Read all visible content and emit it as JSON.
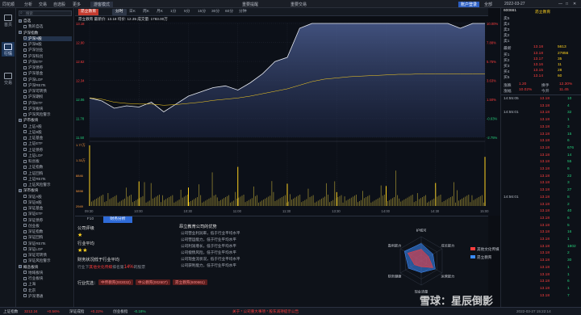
{
  "window": {
    "title": "同花顺",
    "menu": [
      "分析",
      "交易",
      "自选股",
      "更多"
    ],
    "mode_label": "游客模式",
    "center_left": "重要提醒",
    "center_right": "重要交易",
    "top_right": [
      "账户登录",
      "全部",
      "2022-03-27"
    ]
  },
  "leftnav": [
    {
      "label": "首页"
    },
    {
      "label": "行情"
    },
    {
      "label": "交易"
    }
  ],
  "tree": {
    "search_placeholder": "搜索",
    "items": [
      {
        "label": "自选",
        "folder": true
      },
      {
        "label": "我的自选",
        "folder": false
      },
      {
        "label": "沪深指数",
        "folder": true
      },
      {
        "label": "沪深A股",
        "folder": false,
        "selected": true
      },
      {
        "label": "沪深B股",
        "folder": false
      },
      {
        "label": "沪深创业",
        "folder": false
      },
      {
        "label": "沪深科创",
        "folder": false
      },
      {
        "label": "沪深ETF",
        "folder": false
      },
      {
        "label": "沪深债券",
        "folder": false
      },
      {
        "label": "沪深基金",
        "folder": false
      },
      {
        "label": "沪深LOF",
        "folder": false
      },
      {
        "label": "沪深REITs",
        "folder": false
      },
      {
        "label": "沪深可转债",
        "folder": false
      },
      {
        "label": "沪深期权",
        "folder": false
      },
      {
        "label": "沪深ETF",
        "folder": false
      },
      {
        "label": "沪深板块",
        "folder": false
      },
      {
        "label": "沪深风险警示",
        "folder": false
      },
      {
        "label": "沪市板块",
        "folder": true
      },
      {
        "label": "上证A股",
        "folder": false
      },
      {
        "label": "上证B股",
        "folder": false
      },
      {
        "label": "上证基金",
        "folder": false
      },
      {
        "label": "上证ETF",
        "folder": false
      },
      {
        "label": "上证债券",
        "folder": false
      },
      {
        "label": "上证LOF",
        "folder": false
      },
      {
        "label": "科创板",
        "folder": false
      },
      {
        "label": "上证指数",
        "folder": false
      },
      {
        "label": "上证回购",
        "folder": false
      },
      {
        "label": "上证REITs",
        "folder": false
      },
      {
        "label": "上证风险警示",
        "folder": false
      },
      {
        "label": "深市板块",
        "folder": true
      },
      {
        "label": "深证A股",
        "folder": false
      },
      {
        "label": "深证B股",
        "folder": false
      },
      {
        "label": "深证基金",
        "folder": false
      },
      {
        "label": "深证ETF",
        "folder": false
      },
      {
        "label": "深证债券",
        "folder": false
      },
      {
        "label": "创业板",
        "folder": false
      },
      {
        "label": "深证指数",
        "folder": false
      },
      {
        "label": "深证回购",
        "folder": false
      },
      {
        "label": "深证REITs",
        "folder": false
      },
      {
        "label": "深证LOF",
        "folder": false
      },
      {
        "label": "深证可转债",
        "folder": false
      },
      {
        "label": "深证风险警示",
        "folder": false
      },
      {
        "label": "概念板块",
        "folder": true
      },
      {
        "label": "地域板块",
        "folder": false
      },
      {
        "label": "行业板块",
        "folder": false
      },
      {
        "label": "上海",
        "folder": false
      },
      {
        "label": "北京",
        "folder": false
      },
      {
        "label": "沪深港通",
        "folder": false
      }
    ]
  },
  "chart_tabs": [
    "分时",
    "日K",
    "周K",
    "月K",
    "1分",
    "5分",
    "15分",
    "30分",
    "60分",
    "分钟"
  ],
  "chart_tab_active": 0,
  "chart_info": "昂立教育  最新价: 13.18  均价: 12.35  成交量: 1783.00万",
  "chart_data": [
    {
      "type": "line",
      "title": "",
      "x": [
        "09:30",
        "09:35",
        "09:40",
        "09:45",
        "09:50",
        "09:55",
        "10:00",
        "10:05",
        "10:10",
        "10:15",
        "10:20",
        "10:25",
        "10:30",
        "10:35",
        "10:40",
        "10:45",
        "10:50",
        "10:55",
        "11:00",
        "11:05",
        "11:10",
        "11:15",
        "11:20",
        "11:25",
        "11:30",
        "13:00",
        "13:30",
        "14:00",
        "14:30",
        "14:45",
        "14:50",
        "14:55",
        "15:00"
      ],
      "series": [
        {
          "values": [
            11.95,
            11.9,
            11.78,
            11.82,
            11.8,
            11.88,
            11.72,
            11.85,
            11.98,
            12.05,
            12.12,
            12.15,
            12.08,
            12.2,
            12.35,
            12.55,
            12.62,
            13.1,
            13.18,
            13.18,
            13.18,
            13.18,
            13.18,
            13.18,
            13.18,
            13.18,
            13.18,
            13.18,
            13.18,
            13.18,
            13.1,
            13.18,
            13.18
          ]
        },
        {
          "values": [
            11.95,
            11.93,
            11.88,
            11.86,
            11.85,
            11.85,
            11.83,
            11.84,
            11.86,
            11.88,
            11.91,
            11.93,
            11.95,
            11.98,
            12.02,
            12.06,
            12.1,
            12.16,
            12.22,
            12.26,
            12.28,
            12.3,
            12.31,
            12.32,
            12.33,
            12.34,
            12.34,
            12.35,
            12.35,
            12.35,
            12.35,
            12.35,
            12.35
          ]
        }
      ],
      "ylim": [
        11.3,
        13.18
      ],
      "y_left_ticks": [
        "13.18",
        "12.90",
        "12.62",
        "12.34",
        "12.06",
        "11.78",
        "11.50"
      ],
      "y_right_ticks": [
        "10.00%",
        "7.88%",
        "5.75%",
        "3.63%",
        "1.50%",
        "-0.63%",
        "-2.75%"
      ]
    },
    {
      "type": "bar",
      "title": "",
      "categories": [
        "09:30",
        "10:00",
        "10:30",
        "11:00",
        "11:30",
        "13:30",
        "14:00",
        "14:30",
        "15:00"
      ],
      "values": [
        7.9,
        3.2,
        2.4,
        5.1,
        2.9,
        1.8,
        2.6,
        3.0,
        6.4
      ],
      "y_ticks": [
        "1.77万",
        "1.33万",
        "8846",
        "5898",
        "2949"
      ],
      "x_ticks": [
        "09:30",
        "10:00",
        "10:30",
        "11:00",
        "11:30",
        "13:30",
        "14:00",
        "14:30",
        "15:00"
      ]
    }
  ],
  "bottom": {
    "tabs": [
      "F10",
      "财务分析"
    ],
    "active_tab": 1,
    "company_title": "公司评级",
    "stars_1": "★",
    "industry_title": "行业平均",
    "stars_2": "★★",
    "fin_line_prefix": "财务状况低于行业平均",
    "fin_detail_prefix": "行业下",
    "fin_detail_company": "其他文化传媒",
    "fin_detail_mid": "排名第",
    "fin_detail_rank": "14%",
    "fin_detail_suffix": "的股票",
    "diagnosis_title": "昂立教育公司的优势",
    "diagnosis_items": [
      "公司营业利润率，低于行业平均水平",
      "公司营运能力，低于行业平均水平",
      "公司利润增长，低于行业平均水平",
      "公司偿债风险，低于行业平均水平",
      "公司现金流状况，低于行业平均水平",
      "公司获利能力，低于行业平均水平"
    ],
    "peer_label": "行业优选：",
    "peers": [
      "中传教育(003032)",
      "中公教育(002607)",
      "昂立教育(600661)"
    ],
    "radar_labels": [
      "护城河",
      "成长能力",
      "运营能力",
      "现金流量",
      "财务健康",
      "盈利能力"
    ],
    "radar_company": [
      0.3,
      0.22,
      0.35,
      0.15,
      0.2,
      0.4
    ],
    "radar_industry": [
      0.45,
      0.35,
      0.42,
      0.3,
      0.38,
      0.5
    ],
    "legend": [
      "其他文化传媒",
      "昂立教育"
    ],
    "colors": {
      "company": "#ff3d3d",
      "industry": "#3b8cff"
    }
  },
  "quote": {
    "code": "600661",
    "name": "昂立教育",
    "sell": [
      [
        "卖5",
        "",
        ""
      ],
      [
        "卖4",
        "",
        ""
      ],
      [
        "卖3",
        "",
        ""
      ],
      [
        "卖2",
        "",
        ""
      ],
      [
        "卖1",
        "",
        ""
      ]
    ],
    "last_label": "最新",
    "last": "13.18",
    "open_label": "开盘",
    "open": "11.98",
    "buy": [
      [
        "买1",
        "13.18",
        "27856"
      ],
      [
        "买2",
        "13.17",
        "35"
      ],
      [
        "买3",
        "13.16",
        "11"
      ],
      [
        "买4",
        "13.15",
        "28"
      ],
      [
        "买5",
        "13.14",
        "60"
      ]
    ],
    "buy_extra": "5613",
    "stats": [
      [
        "涨跌",
        "1.20",
        "换手",
        "12.30%"
      ],
      [
        "涨幅",
        "10.02%",
        "今开",
        "11.45"
      ]
    ],
    "ticks": [
      [
        "14:55:05",
        "13.18",
        "10"
      ],
      [
        "",
        "13.18",
        "4"
      ],
      [
        "14:55:01",
        "13.18",
        "32"
      ],
      [
        "",
        "13.18",
        "1"
      ],
      [
        "",
        "13.18",
        "3"
      ],
      [
        "",
        "13.18",
        "15"
      ],
      [
        "",
        "13.18",
        "6"
      ],
      [
        "",
        "13.18",
        "676"
      ],
      [
        "",
        "13.18",
        "14"
      ],
      [
        "",
        "13.18",
        "55"
      ],
      [
        "",
        "13.18",
        "6"
      ],
      [
        "",
        "13.18",
        "22"
      ],
      [
        "",
        "13.18",
        "3"
      ],
      [
        "",
        "13.18",
        "27"
      ],
      [
        "14:56:01",
        "13.18",
        "8"
      ],
      [
        "",
        "13.18",
        "2"
      ],
      [
        "",
        "13.18",
        "40"
      ],
      [
        "",
        "13.18",
        "6"
      ],
      [
        "",
        "13.18",
        "5"
      ],
      [
        "",
        "13.18",
        "16"
      ],
      [
        "",
        "13.18",
        "1"
      ],
      [
        "",
        "13.18",
        "1802"
      ],
      [
        "",
        "13.18",
        "2"
      ],
      [
        "",
        "13.18",
        "30"
      ],
      [
        "",
        "13.18",
        "1"
      ],
      [
        "",
        "13.18",
        "1"
      ],
      [
        "",
        "13.18",
        "6"
      ],
      [
        "",
        "13.18",
        "1"
      ],
      [
        "",
        "13.18",
        "7"
      ]
    ]
  },
  "status": {
    "index1_name": "上证指数",
    "index1_val": "3212.24",
    "index1_chg": "+0.56%",
    "index2_name": "深证成指",
    "index2_chg": "+0.22%",
    "index3_name": "创业板指",
    "index3_chg": "-0.18%",
    "news": "关于 * 公司重大事项 * 股东减持提示公告",
    "right": "2022-03-27 15:22:14",
    "watermark": "雪球：星辰倒影"
  }
}
